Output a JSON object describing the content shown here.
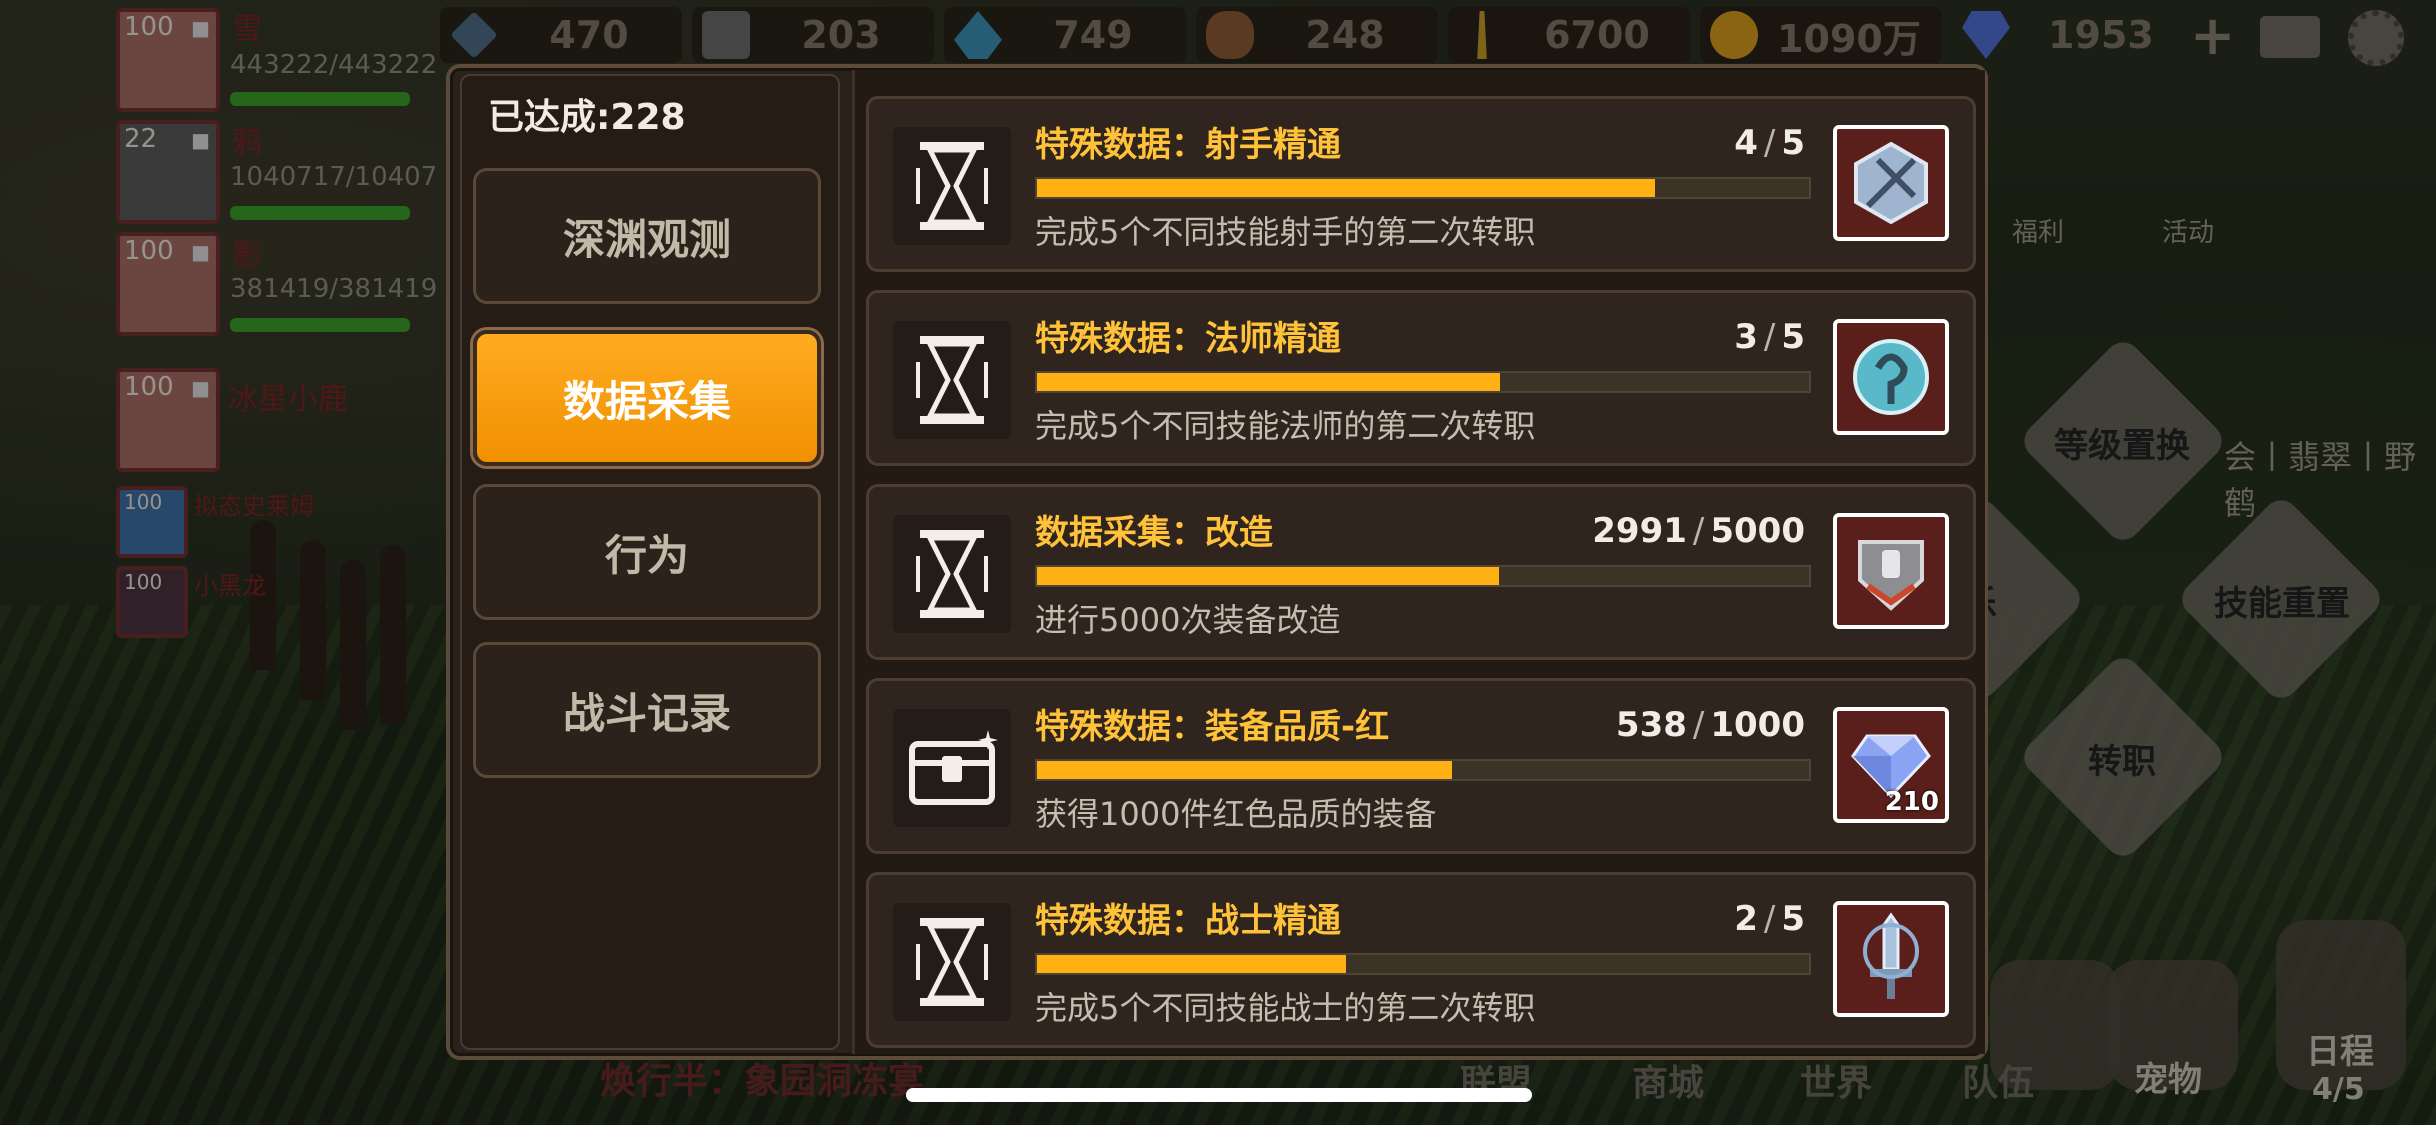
{
  "resources": [
    {
      "icon": "stone-icon",
      "value": "470",
      "color": "#4f6c86"
    },
    {
      "icon": "iron-ore-icon",
      "value": "203",
      "color": "#6a6a6a"
    },
    {
      "icon": "crystal-icon",
      "value": "749",
      "color": "#3d8fb3"
    },
    {
      "icon": "wood-icon",
      "value": "248",
      "color": "#8a5a33"
    },
    {
      "icon": "wheat-icon",
      "value": "6700",
      "color": "#c29a2a"
    },
    {
      "icon": "gold-coin-icon",
      "value": "1090万",
      "color": "#d49a1e"
    },
    {
      "icon": "diamond-icon",
      "value": "1953",
      "color": "#4d6fd1"
    }
  ],
  "topbar": {
    "plus_label": "+"
  },
  "party": [
    {
      "level": "100",
      "name": "雪",
      "hp": "443222/443222",
      "hp_fraction": 1.0
    },
    {
      "level": "22",
      "name": "鸦",
      "hp": "1040717/10407",
      "hp_fraction": 1.0
    },
    {
      "level": "100",
      "name": "影",
      "hp": "381419/381419",
      "hp_fraction": 1.0
    },
    {
      "level": "100",
      "name": "冰星小鹿"
    },
    {
      "level": "100",
      "name": "拟态史莱姆"
    },
    {
      "level": "100",
      "name": "小黑龙"
    }
  ],
  "side": {
    "welfare": "福利",
    "event": "活动",
    "level_swap": "等级置换",
    "skill_reset": "技能重置",
    "job_change": "转职",
    "partial_left": "乐",
    "guild_text": "会丨翡翠丨野鹤"
  },
  "bottom_nav": {
    "alliance": "联盟",
    "shop": "商城",
    "world": "世界",
    "team": "队伍",
    "pet": "宠物",
    "schedule": "日程",
    "schedule_count": "4/5"
  },
  "chat_hint": "焕行半：象园洞冻宴",
  "panel": {
    "achieved_label": "已达成:228",
    "tabs": [
      {
        "label": "深渊观测",
        "active": false
      },
      {
        "label": "数据采集",
        "active": true
      },
      {
        "label": "行为",
        "active": false
      },
      {
        "label": "战斗记录",
        "active": false
      }
    ],
    "achievements": [
      {
        "title": "特殊数据：射手精通",
        "current": "4",
        "total": "5",
        "progress": 0.8,
        "desc": "完成5个不同技能射手的第二次转职",
        "badge": "hourglass-icon",
        "reward": "archer-emblem-icon",
        "reward_count": ""
      },
      {
        "title": "特殊数据：法师精通",
        "current": "3",
        "total": "5",
        "progress": 0.6,
        "desc": "完成5个不同技能法师的第二次转职",
        "badge": "hourglass-icon",
        "reward": "mage-emblem-icon",
        "reward_count": ""
      },
      {
        "title": "数据采集：改造",
        "current": "2991",
        "total": "5000",
        "progress": 0.598,
        "desc": "进行5000次装备改造",
        "badge": "hourglass-icon",
        "reward": "armor-shield-icon",
        "reward_count": ""
      },
      {
        "title": "特殊数据：装备品质-红",
        "current": "538",
        "total": "1000",
        "progress": 0.538,
        "desc": "获得1000件红色品质的装备",
        "badge": "treasure-chest-icon",
        "reward": "diamond-icon",
        "reward_count": "210"
      },
      {
        "title": "特殊数据：战士精通",
        "current": "2",
        "total": "5",
        "progress": 0.4,
        "desc": "完成5个不同技能战士的第二次转职",
        "badge": "hourglass-icon",
        "reward": "warrior-sword-emblem-icon",
        "reward_count": ""
      }
    ]
  }
}
